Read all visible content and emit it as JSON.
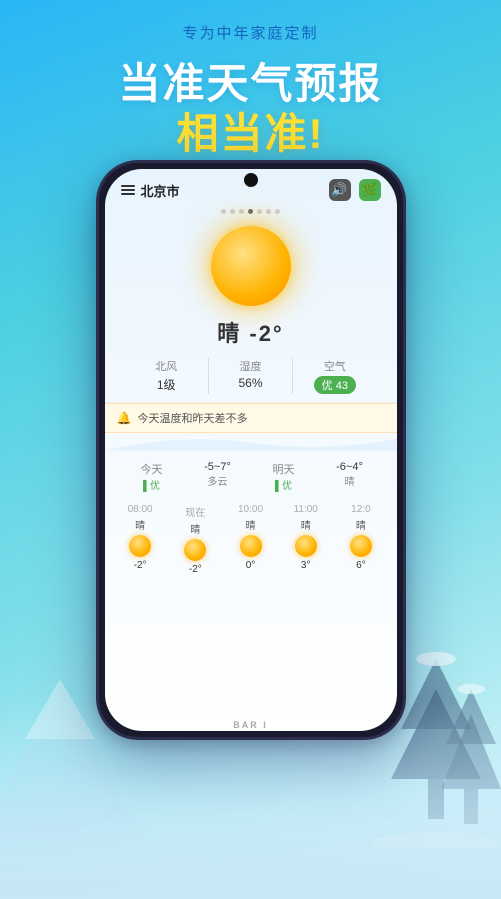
{
  "app": {
    "subtitle": "专为中年家庭定制",
    "headline1": "当准天气预报",
    "headline2": "相当准!"
  },
  "phone": {
    "city": "北京市",
    "dots": [
      0,
      1,
      2,
      3,
      4,
      5,
      6
    ],
    "activeDot": 3,
    "weather": "晴  -2°",
    "wind_label": "北风",
    "wind_value": "1级",
    "humidity_label": "湿度",
    "humidity_value": "56%",
    "air_label": "空气",
    "air_badge": "优 43",
    "alert": "今天温度和昨天差不多",
    "forecast": [
      {
        "label": "今天",
        "temp": "-5~7°",
        "desc": "",
        "quality": "▌优"
      },
      {
        "label": "",
        "temp": "多云",
        "desc": "",
        "quality": ""
      },
      {
        "label": "明天",
        "temp": "-6~4°",
        "desc": "",
        "quality": "▌优"
      },
      {
        "label": "",
        "temp": "晴",
        "desc": "",
        "quality": ""
      }
    ],
    "hourly": [
      {
        "time": "08:00",
        "label": "晴",
        "temp": "-2°"
      },
      {
        "time": "现在",
        "label": "晴",
        "temp": "-2°"
      },
      {
        "time": "10:00",
        "label": "晴",
        "temp": "0°"
      },
      {
        "time": "11:00",
        "label": "晴",
        "temp": "3°"
      },
      {
        "time": "12:0",
        "label": "晴",
        "temp": "6°"
      }
    ]
  },
  "bar_label": "BAR I"
}
